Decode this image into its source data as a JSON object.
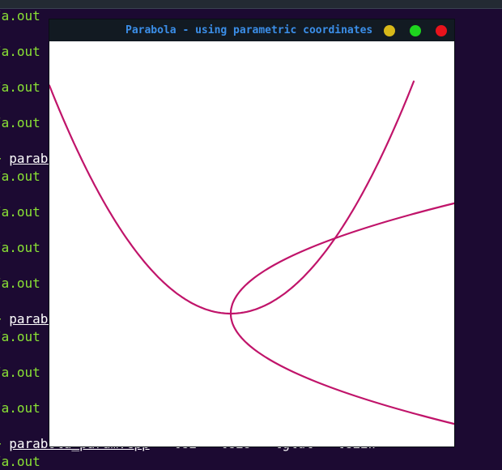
{
  "terminal": {
    "lines": [
      "/a.out",
      "/a.out",
      "/a.out",
      "/a.out",
      {
        "prompt": "+ ",
        "cmd": "parabola_param.cpp",
        "args": ""
      },
      "/a.out",
      "/a.out",
      "/a.out",
      "/a.out",
      {
        "prompt": "+ ",
        "cmd": "parabola_param.cpp",
        "args": ""
      },
      "/a.out",
      "/a.out",
      "/a.out",
      {
        "prompt": "+ ",
        "cmd": "parabola_param.cpp",
        "args": "  -lGL  -lGLU  -lglut  -lGLEW"
      },
      "/a.out"
    ]
  },
  "window": {
    "title": "Parabola - using parametric coordinates",
    "buttons": {
      "minimize": "minimize",
      "maximize": "maximize",
      "close": "close"
    },
    "colors": {
      "titlebar": "#121a22",
      "title_text": "#3b8ee8",
      "minimize": "#d7b819",
      "maximize": "#1ed51e",
      "close": "#e8131c",
      "curve": "#c0146a",
      "canvas": "#ffffff"
    }
  }
}
